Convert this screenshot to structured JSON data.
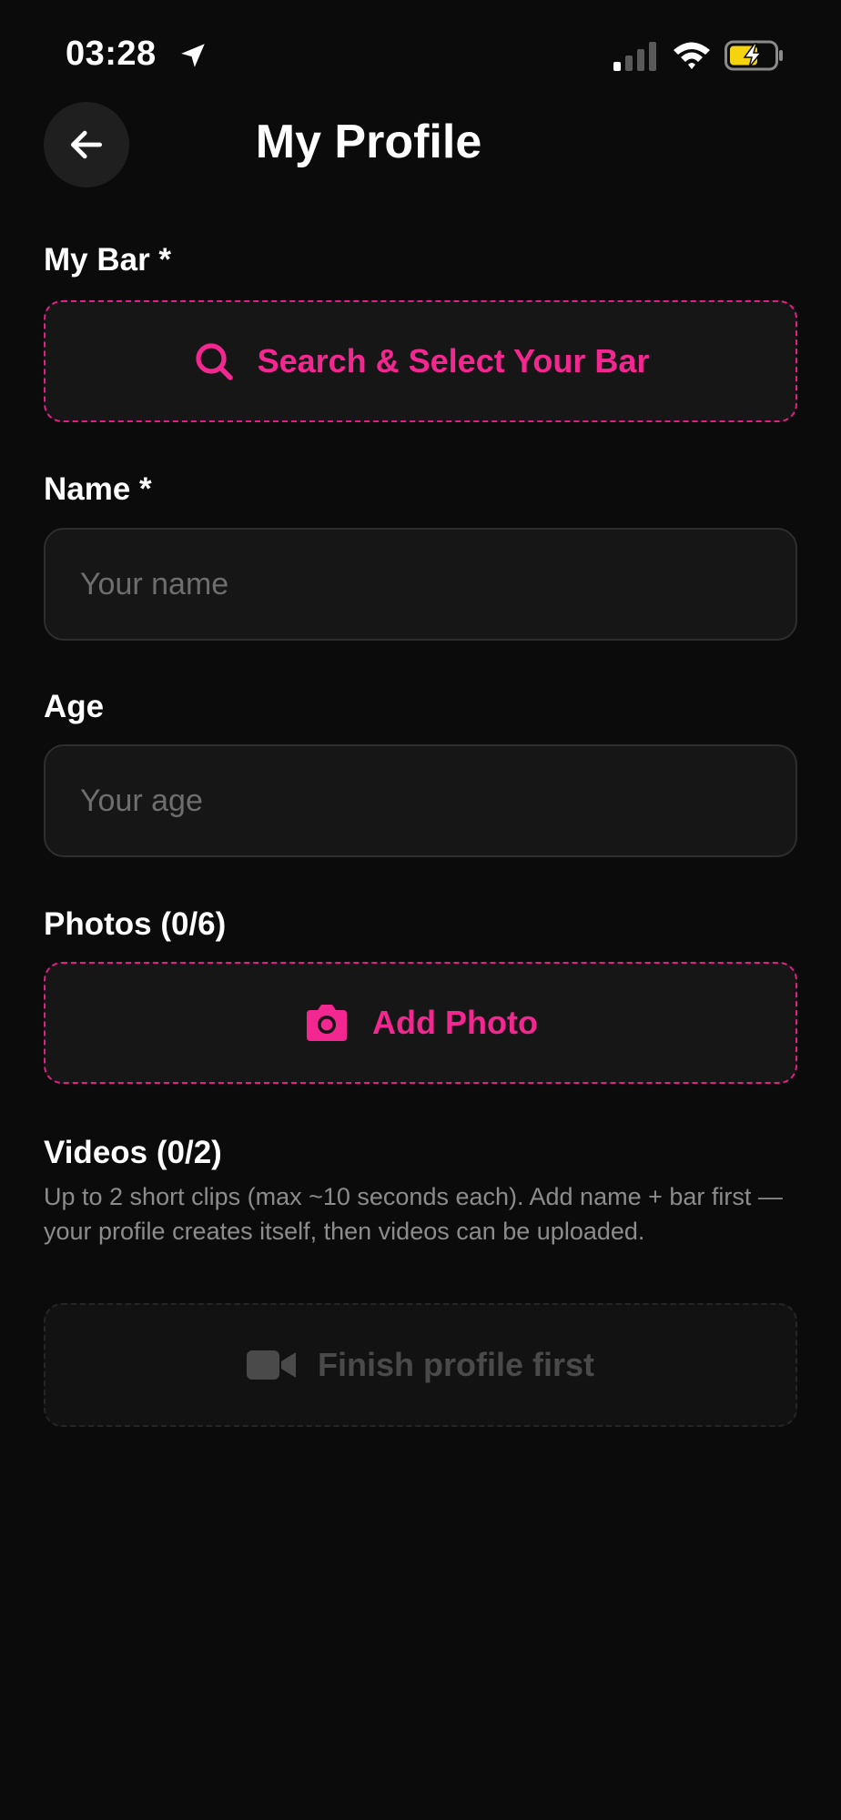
{
  "status_bar": {
    "time": "03:28",
    "icons": [
      "location-arrow-icon",
      "cellular-signal-icon",
      "wifi-icon",
      "battery-charging-icon"
    ]
  },
  "header": {
    "back_icon": "arrow-left-icon",
    "title": "My Profile"
  },
  "form": {
    "bar": {
      "label": "My Bar *",
      "button_label": "Search & Select Your Bar",
      "icon": "search-icon"
    },
    "name": {
      "label": "Name *",
      "value": "",
      "placeholder": "Your name"
    },
    "age": {
      "label": "Age",
      "value": "",
      "placeholder": "Your age"
    },
    "photos": {
      "label": "Photos (0/6)",
      "button_label": "Add Photo",
      "icon": "camera-icon"
    },
    "videos": {
      "label": "Videos (0/2)",
      "help": "Up to 2 short clips (max ~10 seconds each). Add name + bar first — your profile creates itself, then videos can be uploaded.",
      "button_label": "Finish profile first",
      "icon": "video-camera-icon"
    }
  },
  "colors": {
    "background": "#0b0b0b",
    "accent": "#f2278f",
    "field_background": "#161616",
    "muted_text": "#8c8c8c",
    "disabled_text": "#4a4a4a"
  }
}
